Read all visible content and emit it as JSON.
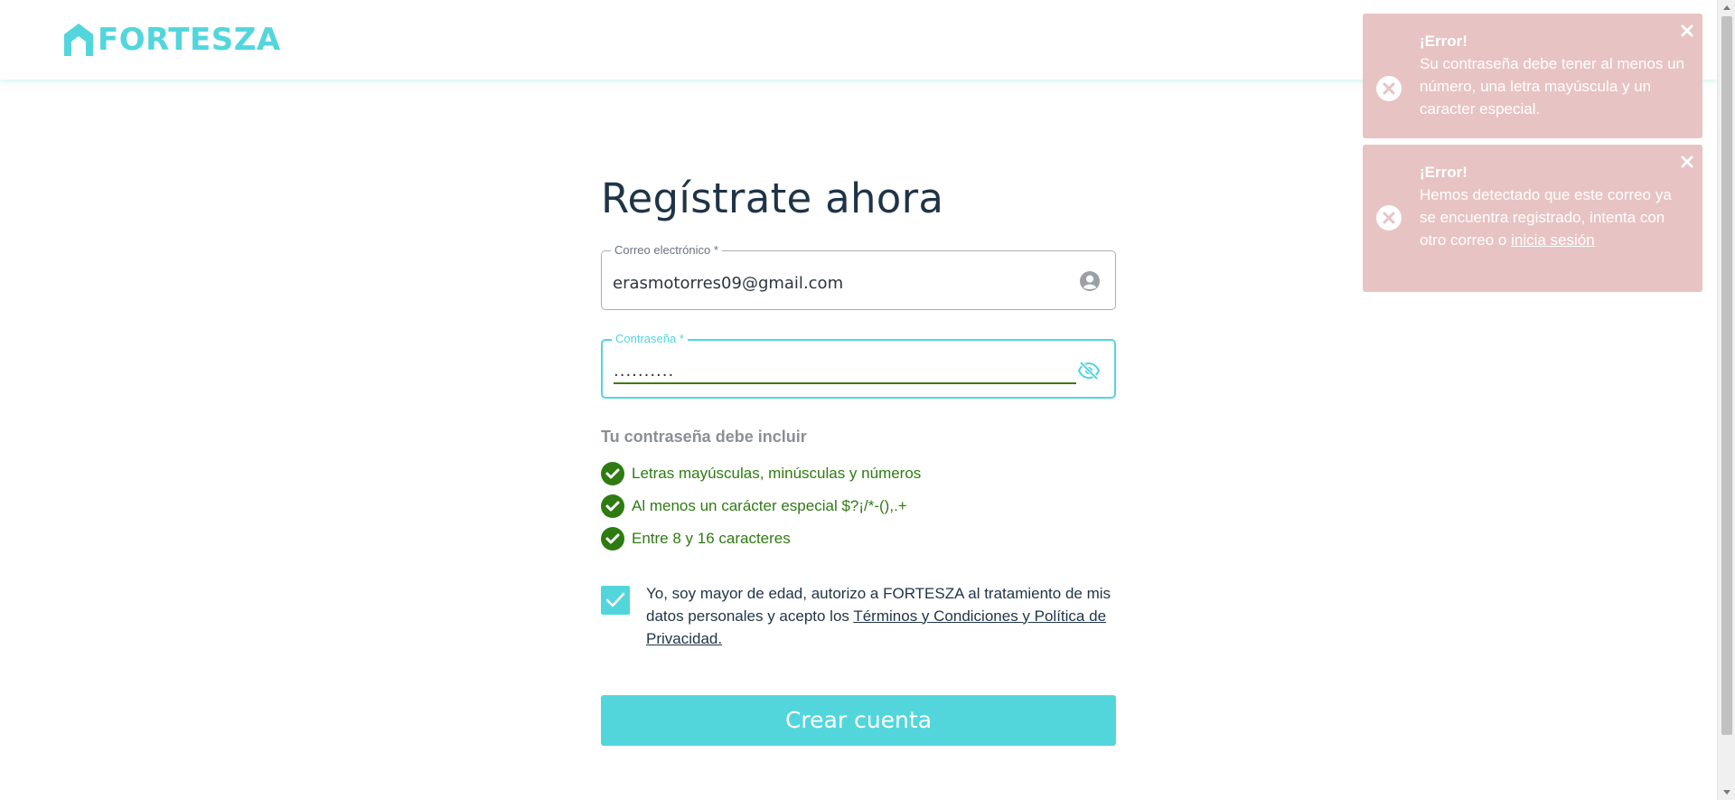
{
  "header": {
    "logo_text": "FORTESZA",
    "brand_color": "#52d6dc"
  },
  "form": {
    "title": "Regístrate ahora",
    "email": {
      "label": "Correo electrónico *",
      "value": "erasmotorres09@gmail.com",
      "icon": "user-circle-icon"
    },
    "password": {
      "label": "Contraseña *",
      "value": "..........",
      "icon": "eye-slash-icon"
    },
    "requirements": {
      "title": "Tu contraseña debe incluir",
      "items": [
        "Letras mayúsculas, minúsculas y números",
        "Al menos un carácter especial $?¡/*-(),.+",
        "Entre 8 y 16 caracteres"
      ],
      "status_color": "#2e7b12"
    },
    "consent": {
      "checked": true,
      "text_prefix": "Yo, soy mayor de edad, autorizo a FORTESZA al tratamiento de mis datos personales y acepto los ",
      "link_text": "Términos y Condiciones y Política de Privacidad."
    },
    "submit_label": "Crear cuenta"
  },
  "toasts": [
    {
      "title": "¡Error!",
      "message": "Su contraseña debe tener al menos un número, una letra mayúscula y un caracter especial.",
      "color": "#e8c3c3"
    },
    {
      "title": "¡Error!",
      "message_prefix": "Hemos detectado que este correo ya se encuentra registrado, intenta con otro correo o ",
      "link_text": "inicia sesión",
      "color": "#e8c3c3"
    }
  ]
}
